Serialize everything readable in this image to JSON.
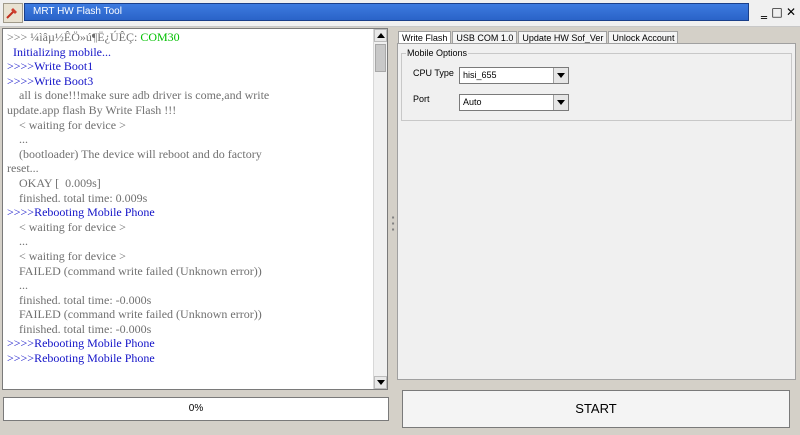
{
  "window": {
    "title": "MRT HW Flash Tool",
    "minimize_glyph": "‗",
    "maximize_glyph": "□",
    "close_glyph": "✕"
  },
  "log": {
    "lines": [
      {
        "text": ">>> ¼ìâµ½ÊÖ»ú¶Ë¿ÚÊÇ: ",
        "tail": "COM30",
        "class": "c-gray"
      },
      {
        "text": "  Initializing mobile...",
        "class": "c-blue"
      },
      {
        "text": ">>>>Write Boot1",
        "class": "c-blue"
      },
      {
        "text": ">>>>Write Boot3",
        "class": "c-blue"
      },
      {
        "text": "    all is done!!!make sure adb driver is come,and write",
        "class": "c-gray"
      },
      {
        "text": "update.app flash By Write Flash !!!",
        "class": "c-gray"
      },
      {
        "text": "    < waiting for device >",
        "class": "c-gray"
      },
      {
        "text": "    ...",
        "class": "c-gray"
      },
      {
        "text": "    (bootloader) The device will reboot and do factory",
        "class": "c-gray"
      },
      {
        "text": "reset...",
        "class": "c-gray"
      },
      {
        "text": "    OKAY [  0.009s]",
        "class": "c-gray"
      },
      {
        "text": "    finished. total time: 0.009s",
        "class": "c-gray"
      },
      {
        "text": ">>>>Rebooting Mobile Phone",
        "class": "c-blue"
      },
      {
        "text": "    < waiting for device >",
        "class": "c-gray"
      },
      {
        "text": "    ...",
        "class": "c-gray"
      },
      {
        "text": "    < waiting for device >",
        "class": "c-gray"
      },
      {
        "text": "    FAILED (command write failed (Unknown error))",
        "class": "c-gray"
      },
      {
        "text": "    ...",
        "class": "c-gray"
      },
      {
        "text": "    finished. total time: -0.000s",
        "class": "c-gray"
      },
      {
        "text": "    FAILED (command write failed (Unknown error))",
        "class": "c-gray"
      },
      {
        "text": "    finished. total time: -0.000s",
        "class": "c-gray"
      },
      {
        "text": ">>>>Rebooting Mobile Phone",
        "class": "c-blue"
      },
      {
        "text": ">>>>Rebooting Mobile Phone",
        "class": "c-blue"
      }
    ]
  },
  "progress": {
    "label": "0%",
    "value": 0
  },
  "tabs": [
    {
      "label": "Write Flash",
      "active": true
    },
    {
      "label": "USB COM 1.0",
      "active": false
    },
    {
      "label": "Update HW Sof_Ver",
      "active": false
    },
    {
      "label": "Unlock Account",
      "active": false
    }
  ],
  "mobile_options": {
    "title": "Mobile Options",
    "cpu_label": "CPU Type",
    "cpu_value": "hisi_655",
    "port_label": "Port",
    "port_value": "Auto"
  },
  "start_button": {
    "label": "START"
  },
  "colors": {
    "title_bar": "#2a63c8",
    "log_blue": "#1414c8",
    "log_green": "#00c000"
  }
}
